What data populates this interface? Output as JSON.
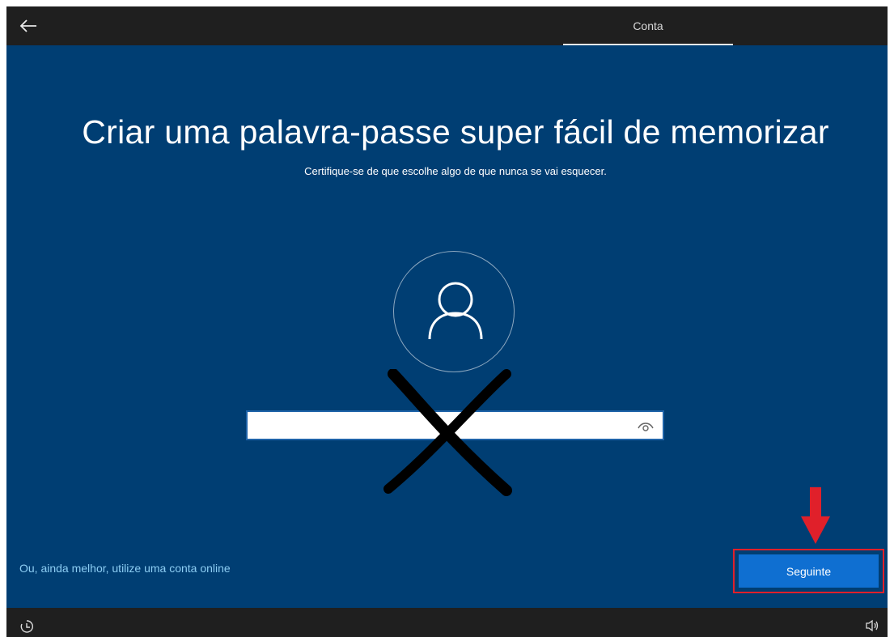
{
  "header": {
    "back_icon": "back-arrow-icon",
    "tab_label": "Conta"
  },
  "main": {
    "title": "Criar uma palavra-passe super fácil de memorizar",
    "subtitle": "Certifique-se de que escolhe algo de que nunca se vai esquecer.",
    "avatar_icon": "user-icon",
    "password": {
      "value": "",
      "placeholder": "",
      "reveal_icon": "eye-icon"
    },
    "annotations": {
      "cross_mark": "x-mark",
      "pointer_arrow": "down-arrow",
      "highlight_color": "#e0202a"
    },
    "online_account_link": "Ou, ainda melhor, utilize uma conta online",
    "next_button": "Seguinte"
  },
  "footer": {
    "left_icon": "ease-of-access-icon",
    "right_icon": "volume-icon"
  },
  "colors": {
    "background": "#003e73",
    "bars": "#1f1f1f",
    "accent": "#0f6fd1",
    "link": "#8ccdf3"
  }
}
